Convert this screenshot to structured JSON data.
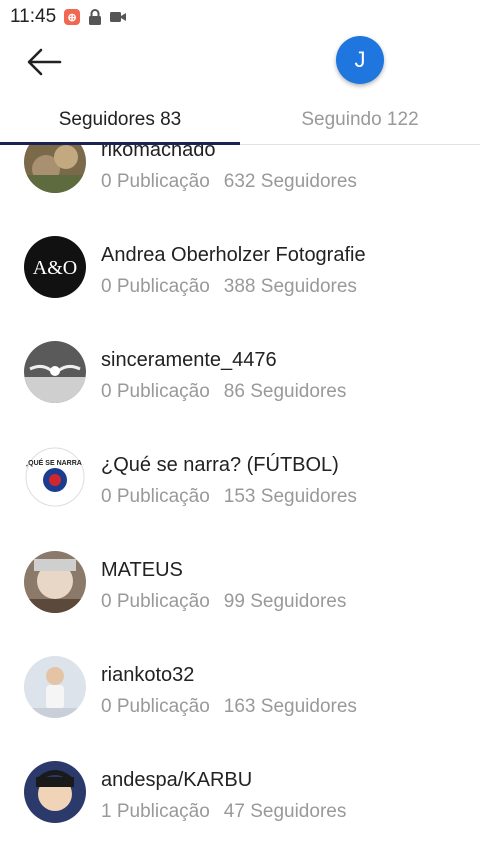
{
  "status_bar": {
    "time": "11:45",
    "app_icon_glyph": "⊕",
    "icons": [
      "app-notification-icon",
      "lock-icon",
      "video-camera-icon"
    ]
  },
  "header": {
    "back_icon": "arrow-left-icon",
    "avatar_initial": "J",
    "avatar_color": "#1e76de"
  },
  "tabs": [
    {
      "label": "Seguidores 83",
      "active": true
    },
    {
      "label": "Seguindo 122",
      "active": false
    }
  ],
  "followers": [
    {
      "name": "rikomachado",
      "posts": "0 Publicação",
      "followers": "632 Seguidores"
    },
    {
      "name": "Andrea Oberholzer Fotografie",
      "posts": "0 Publicação",
      "followers": "388 Seguidores"
    },
    {
      "name": "sinceramente_4476",
      "posts": "0 Publicação",
      "followers": "86 Seguidores"
    },
    {
      "name": "¿Qué se narra? (FÚTBOL)",
      "posts": "0 Publicação",
      "followers": "153 Seguidores"
    },
    {
      "name": "MATEUS",
      "posts": "0 Publicação",
      "followers": "99 Seguidores"
    },
    {
      "name": "riankoto32",
      "posts": "0 Publicação",
      "followers": "163 Seguidores"
    },
    {
      "name": "andespa/KARBU",
      "posts": "1 Publicação",
      "followers": "47 Seguidores"
    }
  ]
}
